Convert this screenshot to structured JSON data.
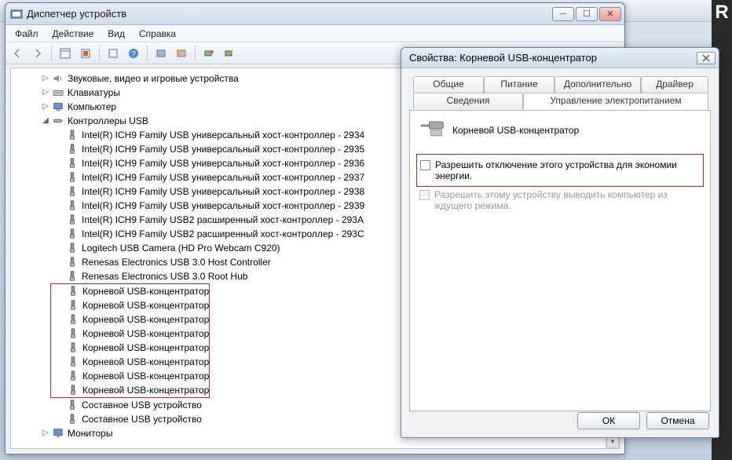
{
  "devmgr": {
    "title": "Диспетчер устройств",
    "menu": {
      "file": "Файл",
      "action": "Действие",
      "view": "Вид",
      "help": "Справка"
    },
    "tree": {
      "sound": "Звуковые, видео и игровые устройства",
      "keyboards": "Клавиатуры",
      "computer": "Компьютер",
      "usb_controllers": "Контроллеры USB",
      "monitors": "Мониторы",
      "usb_children": [
        "Intel(R) ICH9 Family USB универсальный хост-контроллер   - 2934",
        "Intel(R) ICH9 Family USB универсальный хост-контроллер   - 2935",
        "Intel(R) ICH9 Family USB универсальный хост-контроллер   - 2936",
        "Intel(R) ICH9 Family USB универсальный хост-контроллер   - 2937",
        "Intel(R) ICH9 Family USB универсальный хост-контроллер   - 2938",
        "Intel(R) ICH9 Family USB универсальный хост-контроллер   - 2939",
        "Intel(R) ICH9 Family USB2 расширенный хост-контроллер   - 293A",
        "Intel(R) ICH9 Family USB2 расширенный хост-контроллер   - 293C",
        "Logitech USB Camera (HD Pro Webcam C920)",
        "Renesas Electronics USB 3.0 Host Controller",
        "Renesas Electronics USB 3.0 Root Hub",
        "Корневой USB-концентратор",
        "Корневой USB-концентратор",
        "Корневой USB-концентратор",
        "Корневой USB-концентратор",
        "Корневой USB-концентратор",
        "Корневой USB-концентратор",
        "Корневой USB-концентратор",
        "Корневой USB-концентратор",
        "Составное USB устройство",
        "Составное USB устройство"
      ]
    }
  },
  "props": {
    "title": "Свойства: Корневой USB-концентратор",
    "tabs": {
      "general": "Общие",
      "power": "Питание",
      "advanced": "Дополнительно",
      "driver": "Драйвер",
      "details": "Сведения",
      "power_mgmt": "Управление электропитанием"
    },
    "device_name": "Корневой USB-концентратор",
    "checkbox1": "Разрешить отключение этого устройства для экономии энергии.",
    "checkbox2": "Разрешить этому устройству выводить компьютер из ждущего режима.",
    "ok": "ОК",
    "cancel": "Отмена"
  },
  "bg_right_letter": "R"
}
